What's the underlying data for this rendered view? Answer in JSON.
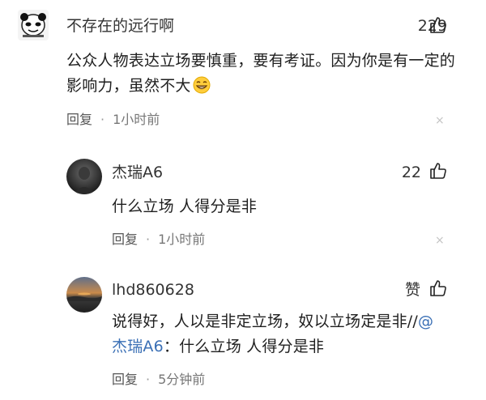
{
  "comments": [
    {
      "username": "不存在的远行啊",
      "likes": "229",
      "text": "公众人物表达立场要慎重，要有考证。因为你是有一定的影响力，虽然不大",
      "reply_label": "回复",
      "separator": "·",
      "time": "1小时前",
      "emoji": "grinning-face"
    },
    {
      "username": "杰瑞A6",
      "likes": "22",
      "text": "什么立场 人得分是非",
      "reply_label": "回复",
      "separator": "·",
      "time": "1小时前"
    },
    {
      "username": "lhd860628",
      "likes": "赞",
      "text_line1": "说得好，人以是非定立场，奴以立场定是非//",
      "mention_at": "@",
      "mention_name": "杰瑞A6",
      "text_rest": "：什么立场 人得分是非",
      "reply_label": "回复",
      "separator": "·",
      "time": "5分钟前"
    }
  ],
  "close_icon": "×",
  "colors": {
    "mention": "#3a6fb5",
    "meta_text": "#777777",
    "close": "#c4c4c4"
  }
}
